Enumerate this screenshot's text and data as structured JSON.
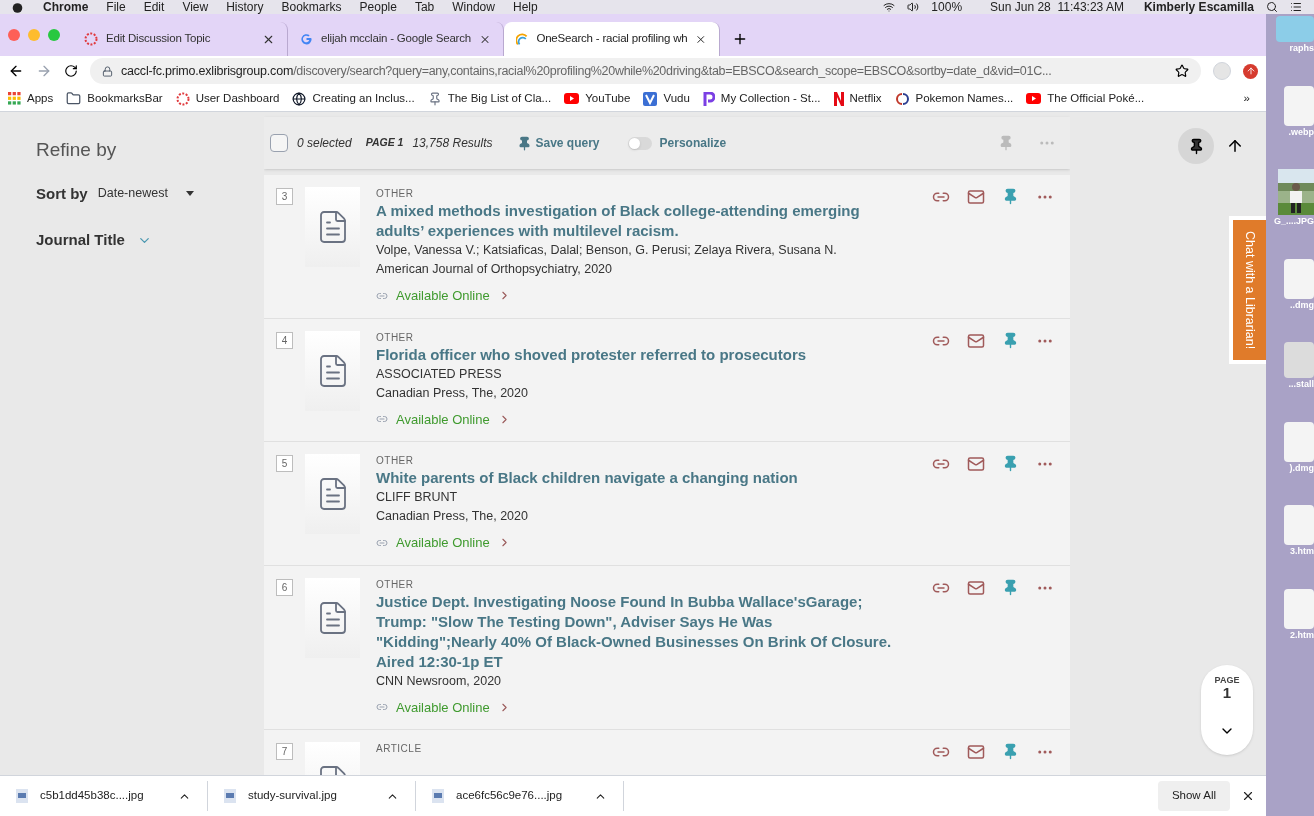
{
  "menubar": {
    "app": "Chrome",
    "items": [
      "File",
      "Edit",
      "View",
      "History",
      "Bookmarks",
      "People",
      "Tab",
      "Window",
      "Help"
    ],
    "battery": "100%",
    "clock": "Sun Jun 28  11:43:23 AM",
    "user": "Kimberly Escamilla"
  },
  "tabs": [
    {
      "title": "Edit Discussion Topic",
      "selected": false,
      "kind": "canvas"
    },
    {
      "title": "elijah mcclain - Google Search",
      "selected": false,
      "kind": "google"
    },
    {
      "title": "OneSearch - racial profiling wh",
      "selected": true,
      "kind": "rainbow"
    }
  ],
  "address": {
    "host": "caccl-fc.primo.exlibrisgroup.com",
    "path": "/discovery/search?query=any,contains,racial%20profiling%20while%20driving&tab=EBSCO&search_scope=EBSCO&sortby=date_d&vid=01C..."
  },
  "bookmarks": [
    {
      "label": "Apps",
      "kind": "grid"
    },
    {
      "label": "BookmarksBar",
      "kind": "folder"
    },
    {
      "label": "User Dashboard",
      "kind": "canvas"
    },
    {
      "label": "Creating an Inclus...",
      "kind": "globe"
    },
    {
      "label": "The Big List of Cla...",
      "kind": "pin"
    },
    {
      "label": "YouTube",
      "kind": "youtube"
    },
    {
      "label": "Vudu",
      "kind": "vudu"
    },
    {
      "label": "My Collection - St...",
      "kind": "p"
    },
    {
      "label": "Netflix",
      "kind": "netflix"
    },
    {
      "label": "Pokemon Names...",
      "kind": "poke"
    },
    {
      "label": "The Official Poké...",
      "kind": "youtube"
    }
  ],
  "bookmarks_more": "»",
  "refine": {
    "title": "Refine by",
    "sort_label": "Sort by",
    "sort_value": "Date-newest",
    "facet": "Journal Title"
  },
  "toolbar": {
    "checked": false,
    "selected_count": "0 selected",
    "page": "PAGE 1",
    "results": "13,758 Results",
    "save": "Save query",
    "personalize": {
      "label": "Personalize",
      "on": false
    }
  },
  "results": [
    {
      "number": "3",
      "type": "OTHER",
      "title": "A mixed methods investigation of Black college-attending emerging adults’ experiences with multilevel racism.",
      "lines": [
        "Volpe, Vanessa V.; Katsiaficas, Dalal; Benson, G. Perusi; Zelaya Rivera, Susana N.",
        "American Journal of Orthopsychiatry, 2020"
      ],
      "availability": "Available Online"
    },
    {
      "number": "4",
      "type": "OTHER",
      "title": "Florida officer who shoved protester referred to prosecutors",
      "lines": [
        "ASSOCIATED PRESS",
        "Canadian Press, The, 2020"
      ],
      "availability": "Available Online"
    },
    {
      "number": "5",
      "type": "OTHER",
      "title": "White parents of Black children navigate a changing nation",
      "lines": [
        "CLIFF BRUNT",
        "Canadian Press, The, 2020"
      ],
      "availability": "Available Online"
    },
    {
      "number": "6",
      "type": "OTHER",
      "title": "Justice Dept. Investigating Noose Found In Bubba Wallace'sGarage; Trump: \"Slow The Testing Down\", Adviser Says He Was \"Kidding\";Nearly 40% Of Black-Owned Businesses On Brink Of Closure. Aired 12:30-1p ET",
      "lines": [
        "CNN Newsroom, 2020"
      ],
      "availability": "Available Online"
    },
    {
      "number": "7",
      "type": "ARTICLE"
    }
  ],
  "chat": "Chat with a Librarian!",
  "page_indicator": {
    "label": "PAGE",
    "number": "1"
  },
  "downloads": [
    "c5b1dd45b38c....jpg",
    "study-survival.jpg",
    "ace6fc56c9e76....jpg"
  ],
  "show_all": "Show All",
  "desktop": [
    {
      "label": "raphs",
      "kind": "folder"
    },
    {
      "label": ".webp",
      "kind": "file"
    },
    {
      "label": "G_....JPG",
      "kind": "picture"
    },
    {
      "label": "..dmg",
      "kind": "file"
    },
    {
      "label": "...stall",
      "kind": "drive"
    },
    {
      "label": ").dmg",
      "kind": "file"
    },
    {
      "label": "3.htm",
      "kind": "file"
    },
    {
      "label": "2.htm",
      "kind": "file"
    }
  ]
}
